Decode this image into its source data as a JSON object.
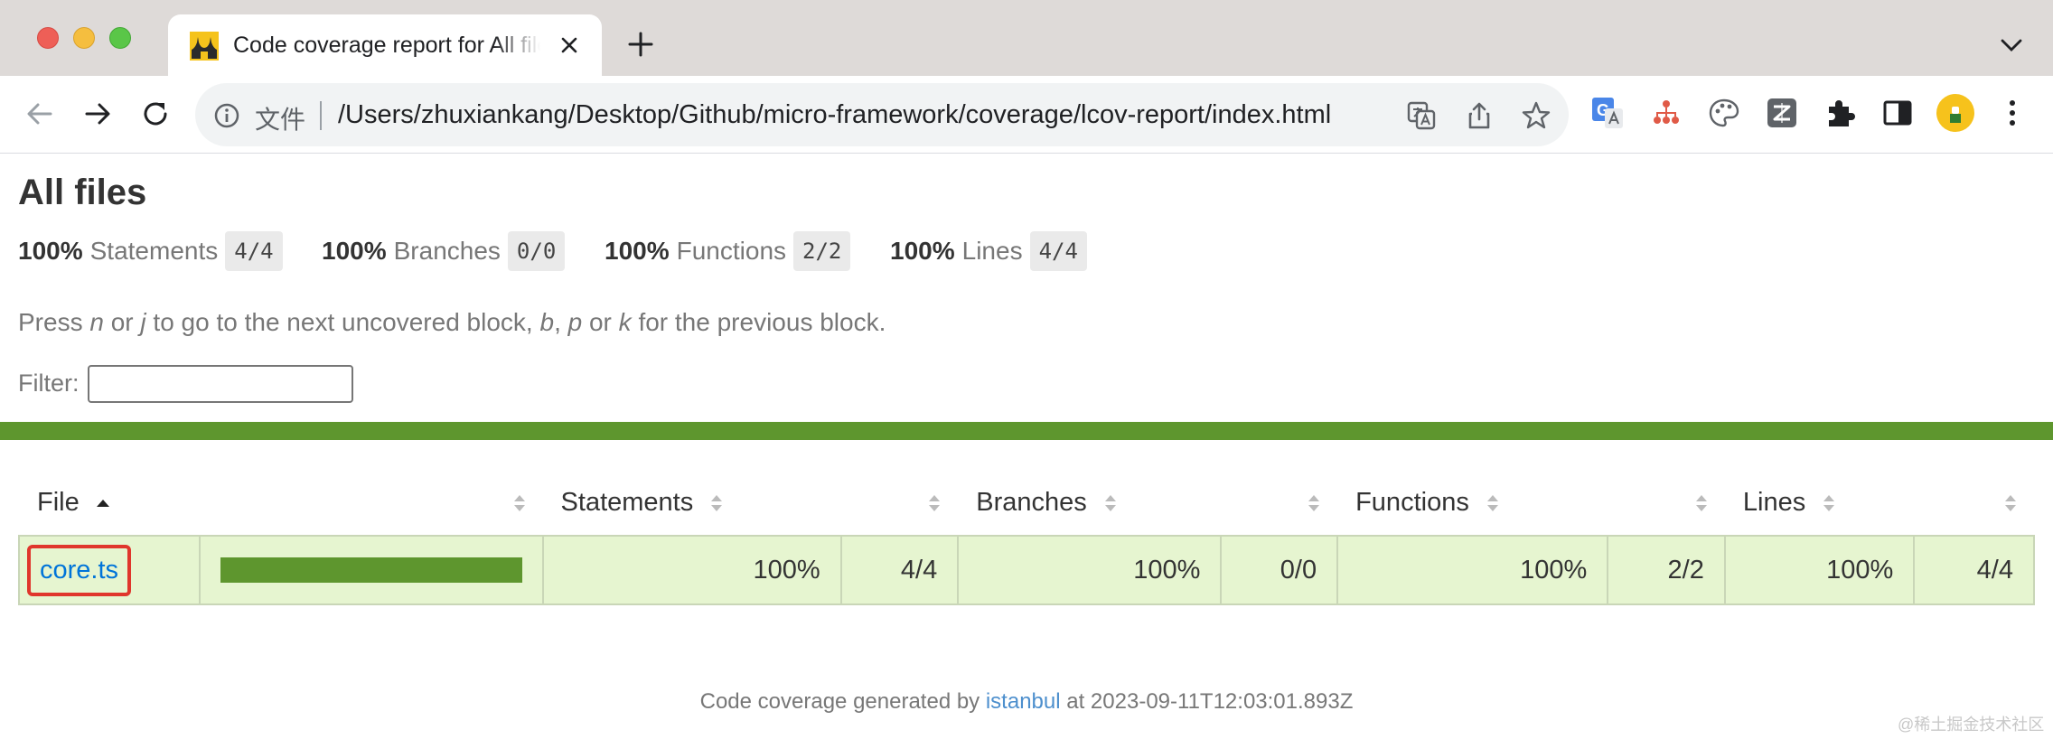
{
  "browser": {
    "tab_title": "Code coverage report for All files",
    "scheme_label": "文件",
    "url": "/Users/zhuxiankang/Desktop/Github/micro-framework/coverage/lcov-report/index.html"
  },
  "page": {
    "title": "All files",
    "summary": [
      {
        "pct": "100%",
        "label": "Statements",
        "fraction": "4/4"
      },
      {
        "pct": "100%",
        "label": "Branches",
        "fraction": "0/0"
      },
      {
        "pct": "100%",
        "label": "Functions",
        "fraction": "2/2"
      },
      {
        "pct": "100%",
        "label": "Lines",
        "fraction": "4/4"
      }
    ],
    "hint": {
      "t1": "Press ",
      "k1": "n",
      "t2": " or ",
      "k2": "j",
      "t3": " to go to the next uncovered block, ",
      "k3": "b",
      "t4": ", ",
      "k4": "p",
      "t5": " or ",
      "k5": "k",
      "t6": " for the previous block."
    },
    "filter_label": "Filter:",
    "filter_value": "",
    "status_color": "#5e962e"
  },
  "table": {
    "headers": {
      "file": "File",
      "statements": "Statements",
      "branches": "Branches",
      "functions": "Functions",
      "lines": "Lines"
    },
    "rows": [
      {
        "file": "core.ts",
        "coverage_fraction": 1.0,
        "statements_pct": "100%",
        "statements": "4/4",
        "branches_pct": "100%",
        "branches": "0/0",
        "functions_pct": "100%",
        "functions": "2/2",
        "lines_pct": "100%",
        "lines": "4/4"
      }
    ]
  },
  "footer": {
    "prefix": "Code coverage generated by ",
    "link": "istanbul",
    "suffix": " at 2023-09-11T12:03:01.893Z"
  },
  "watermark": "@稀土掘金技术社区"
}
